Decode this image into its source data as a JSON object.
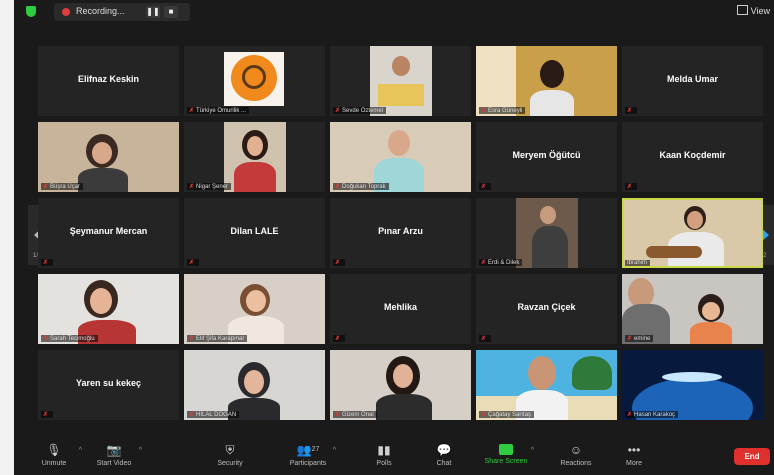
{
  "topbar": {
    "recording_label": "Recording...",
    "pause_label": "❚❚",
    "stop_label": "■",
    "view_label": "View"
  },
  "grid": {
    "page_left": "1/2",
    "page_right": "1/2"
  },
  "participants": [
    {
      "name": "Elifnaz Keskin",
      "label": "",
      "video": false,
      "muted": false
    },
    {
      "name": "",
      "label": "Türkiye Omurilik ...",
      "video": true,
      "muted": true
    },
    {
      "name": "",
      "label": "Sevde Öztemel",
      "video": true,
      "muted": true
    },
    {
      "name": "",
      "label": "Esra Güneyli",
      "video": true,
      "muted": true
    },
    {
      "name": "Melda Umar",
      "label": "",
      "video": false,
      "muted": true
    },
    {
      "name": "",
      "label": "Büşra Uçar",
      "video": true,
      "muted": true
    },
    {
      "name": "",
      "label": "Nigar Şener",
      "video": true,
      "muted": true
    },
    {
      "name": "",
      "label": "Doğukan Toprak",
      "video": true,
      "muted": true
    },
    {
      "name": "Meryem Öğütcü",
      "label": "",
      "video": false,
      "muted": true
    },
    {
      "name": "Kaan Koçdemir",
      "label": "",
      "video": false,
      "muted": true
    },
    {
      "name": "Şeymanur Mercan",
      "label": "",
      "video": false,
      "muted": true
    },
    {
      "name": "Dilan LALE",
      "label": "",
      "video": false,
      "muted": true
    },
    {
      "name": "Pınar Arzu",
      "label": "",
      "video": false,
      "muted": true
    },
    {
      "name": "",
      "label": "Erdi & Dilek",
      "video": true,
      "muted": true
    },
    {
      "name": "",
      "label": "İbrahim",
      "video": true,
      "muted": false
    },
    {
      "name": "",
      "label": "Sarah Tecimoğlu",
      "video": true,
      "muted": true
    },
    {
      "name": "",
      "label": "Elif Şifa Karapınar",
      "video": true,
      "muted": true
    },
    {
      "name": "Mehlika",
      "label": "",
      "video": false,
      "muted": true
    },
    {
      "name": "Ravzan Çiçek",
      "label": "",
      "video": false,
      "muted": true
    },
    {
      "name": "",
      "label": "emine",
      "video": true,
      "muted": true
    },
    {
      "name": "Yaren su kekeç",
      "label": "",
      "video": false,
      "muted": true
    },
    {
      "name": "",
      "label": "HİLAL DOĞAN",
      "video": true,
      "muted": true
    },
    {
      "name": "",
      "label": "Gizem Önal",
      "video": true,
      "muted": true
    },
    {
      "name": "",
      "label": "Çağatay Sarıtaş",
      "video": true,
      "muted": true
    },
    {
      "name": "",
      "label": "Hasan Karakoç",
      "video": true,
      "muted": true
    }
  ],
  "toolbar": {
    "unmute": "Unmute",
    "start_video": "Start Video",
    "security": "Security",
    "participants": "Participants",
    "participants_count": "27",
    "polls": "Polls",
    "chat": "Chat",
    "share_screen": "Share Screen",
    "reactions": "Reactions",
    "more": "More",
    "end": "End"
  },
  "colors": {
    "mute_icon": "#e23b3b",
    "share_screen": "#2ecc40",
    "end_button": "#e0302e",
    "active_speaker_outline": "#c9d94a",
    "page_arrow": "#2ea2f0"
  }
}
